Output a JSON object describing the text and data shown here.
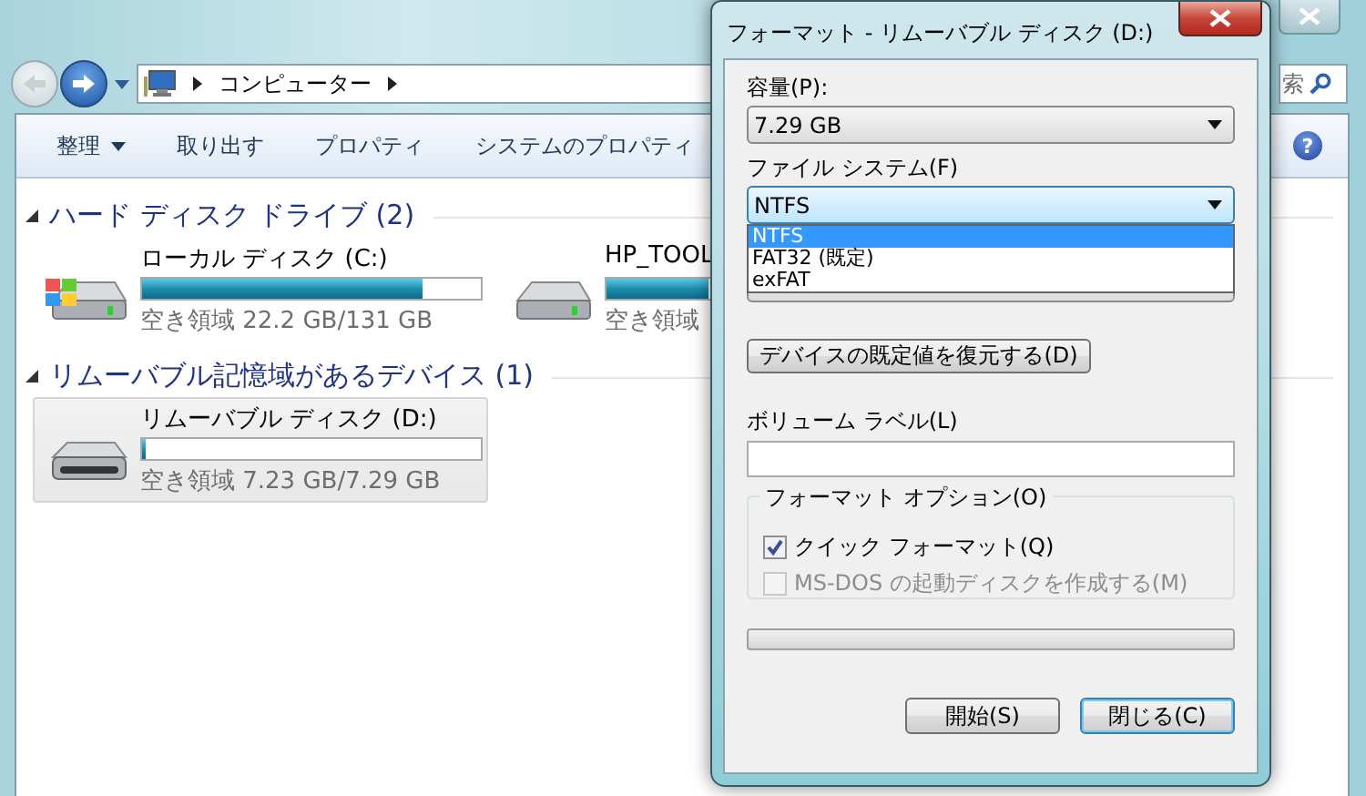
{
  "explorer": {
    "back_button": {
      "disabled": true
    },
    "forward_button": {
      "disabled": false
    },
    "address": {
      "items": [
        "コンピューター"
      ]
    },
    "search": {
      "placeholder": "索"
    },
    "toolbar": [
      {
        "label": "整理",
        "kind": "menu"
      },
      {
        "label": "取り出す",
        "kind": "button"
      },
      {
        "label": "プロパティ",
        "kind": "button"
      },
      {
        "label": "システムのプロパティ",
        "kind": "button"
      }
    ],
    "help_button": {
      "glyph": "?"
    },
    "groups": [
      {
        "title": "ハード ディスク ドライブ (2)",
        "expanded": true,
        "drives": [
          {
            "name": "ローカル ディスク (C:)",
            "kind": "system",
            "level": 0.83,
            "free": "空き領域 22.2 GB/131 GB",
            "selected": false
          },
          {
            "name": "HP_TOOL",
            "kind": "disk",
            "level": 0.3,
            "free": "空き領域",
            "selected": false
          }
        ]
      },
      {
        "title": "リムーバブル記憶域があるデバイス (1)",
        "expanded": true,
        "drives": [
          {
            "name": "リムーバブル ディスク (D:)",
            "kind": "removable",
            "level": 0.01,
            "free": "空き領域 7.23 GB/7.29 GB",
            "selected": true
          }
        ]
      }
    ]
  },
  "dialog": {
    "title": "フォーマット - リムーバブル ディスク (D:)",
    "capacity": {
      "label": "容量(P):",
      "value": "7.29 GB"
    },
    "file_system": {
      "label": "ファイル システム(F)",
      "value": "NTFS",
      "open": true,
      "options": [
        {
          "label": "NTFS",
          "selected": true
        },
        {
          "label": "FAT32 (既定)",
          "selected": false
        },
        {
          "label": "exFAT",
          "selected": false
        }
      ]
    },
    "restore_button": "デバイスの既定値を復元する(D)",
    "volume_label": {
      "label": "ボリューム ラベル(L)"
    },
    "format_options": {
      "title": "フォーマット オプション(O)",
      "items": [
        {
          "label": "クイック フォーマット(Q)",
          "checked": true,
          "disabled": false
        },
        {
          "label": "MS-DOS の起動ディスクを作成する(M)",
          "checked": false,
          "disabled": true
        }
      ]
    },
    "progress": {
      "level": 0
    },
    "buttons": [
      {
        "label": "開始(S)",
        "default": false
      },
      {
        "label": "閉じる(C)",
        "default": true
      }
    ]
  }
}
